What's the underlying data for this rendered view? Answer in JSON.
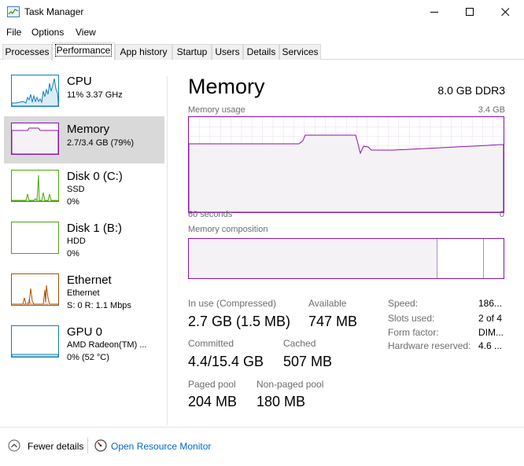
{
  "window": {
    "title": "Task Manager"
  },
  "menu": {
    "file": "File",
    "options": "Options",
    "view": "View"
  },
  "tabs": [
    {
      "label": "Processes"
    },
    {
      "label": "Performance"
    },
    {
      "label": "App history"
    },
    {
      "label": "Startup"
    },
    {
      "label": "Users"
    },
    {
      "label": "Details"
    },
    {
      "label": "Services"
    }
  ],
  "sidebar": {
    "items": [
      {
        "title": "CPU",
        "line1": "11%  3.37 GHz",
        "line2": ""
      },
      {
        "title": "Memory",
        "line1": "2.7/3.4 GB (79%)",
        "line2": ""
      },
      {
        "title": "Disk 0 (C:)",
        "line1": "SSD",
        "line2": "0%"
      },
      {
        "title": "Disk 1 (B:)",
        "line1": "HDD",
        "line2": "0%"
      },
      {
        "title": "Ethernet",
        "line1": "Ethernet",
        "line2": "S: 0  R: 1.1 Mbps"
      },
      {
        "title": "GPU 0",
        "line1": "AMD Radeon(TM) ...",
        "line2": "0%  (52 °C)"
      }
    ]
  },
  "memory": {
    "title": "Memory",
    "spec": "8.0 GB DDR3",
    "usage_label": "Memory usage",
    "usage_max": "3.4 GB",
    "time_label": "60 seconds",
    "time_end": "0",
    "composition_label": "Memory composition",
    "stats": {
      "in_use_label": "In use (Compressed)",
      "in_use_value": "2.7 GB (1.5 MB)",
      "available_label": "Available",
      "available_value": "747 MB",
      "committed_label": "Committed",
      "committed_value": "4.4/15.4 GB",
      "cached_label": "Cached",
      "cached_value": "507 MB",
      "paged_label": "Paged pool",
      "paged_value": "204 MB",
      "nonpaged_label": "Non-paged pool",
      "nonpaged_value": "180 MB"
    },
    "details": {
      "speed_label": "Speed:",
      "speed_value": "186...",
      "slots_label": "Slots used:",
      "slots_value": "2 of 4",
      "form_label": "Form factor:",
      "form_value": "DIM...",
      "reserved_label": "Hardware reserved:",
      "reserved_value": "4.6 ..."
    }
  },
  "footer": {
    "fewer_details": "Fewer details",
    "open_resource_monitor": "Open Resource Monitor"
  },
  "colors": {
    "memory": "#8b12ae",
    "cpu": "#117dbb",
    "disk": "#4da60c",
    "ethernet": "#a74f01"
  }
}
